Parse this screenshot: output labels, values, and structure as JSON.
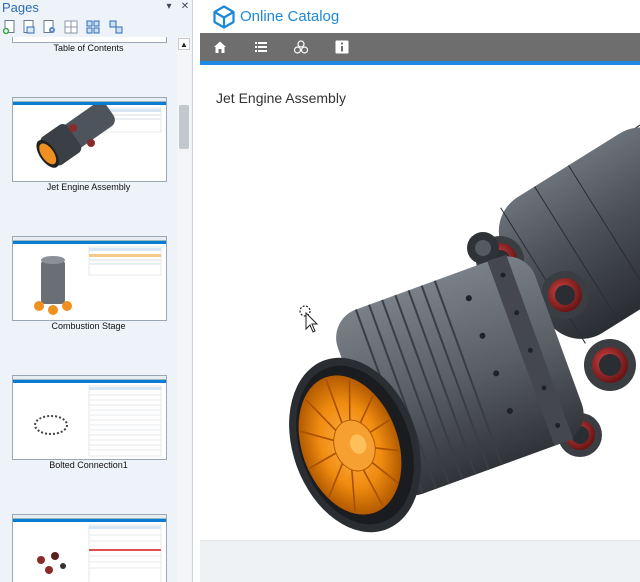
{
  "pages_panel": {
    "title": "Pages",
    "pin_icon": "pin-down-icon",
    "close_icon": "close-icon",
    "toolbar": [
      {
        "name": "add-page-icon"
      },
      {
        "name": "duplicate-page-icon"
      },
      {
        "name": "page-settings-icon"
      },
      {
        "name": "grid-view-icon"
      },
      {
        "name": "layout-icon"
      },
      {
        "name": "arrange-icon"
      }
    ],
    "pages": [
      {
        "label": "Table of Contents"
      },
      {
        "label": "Jet Engine Assembly"
      },
      {
        "label": "Combustion Stage"
      },
      {
        "label": "Bolted Connection1"
      },
      {
        "label": ""
      }
    ]
  },
  "app": {
    "title": "Online Catalog",
    "nav": [
      {
        "name": "home-icon"
      },
      {
        "name": "list-icon"
      },
      {
        "name": "parts-icon"
      },
      {
        "name": "info-icon"
      }
    ],
    "page_title": "Jet Engine Assembly"
  },
  "colors": {
    "brand_blue": "#1e88e5",
    "nav_gray": "#6e6e6e",
    "engine_orange": "#f08c10",
    "engine_gray": "#5a5f66"
  }
}
